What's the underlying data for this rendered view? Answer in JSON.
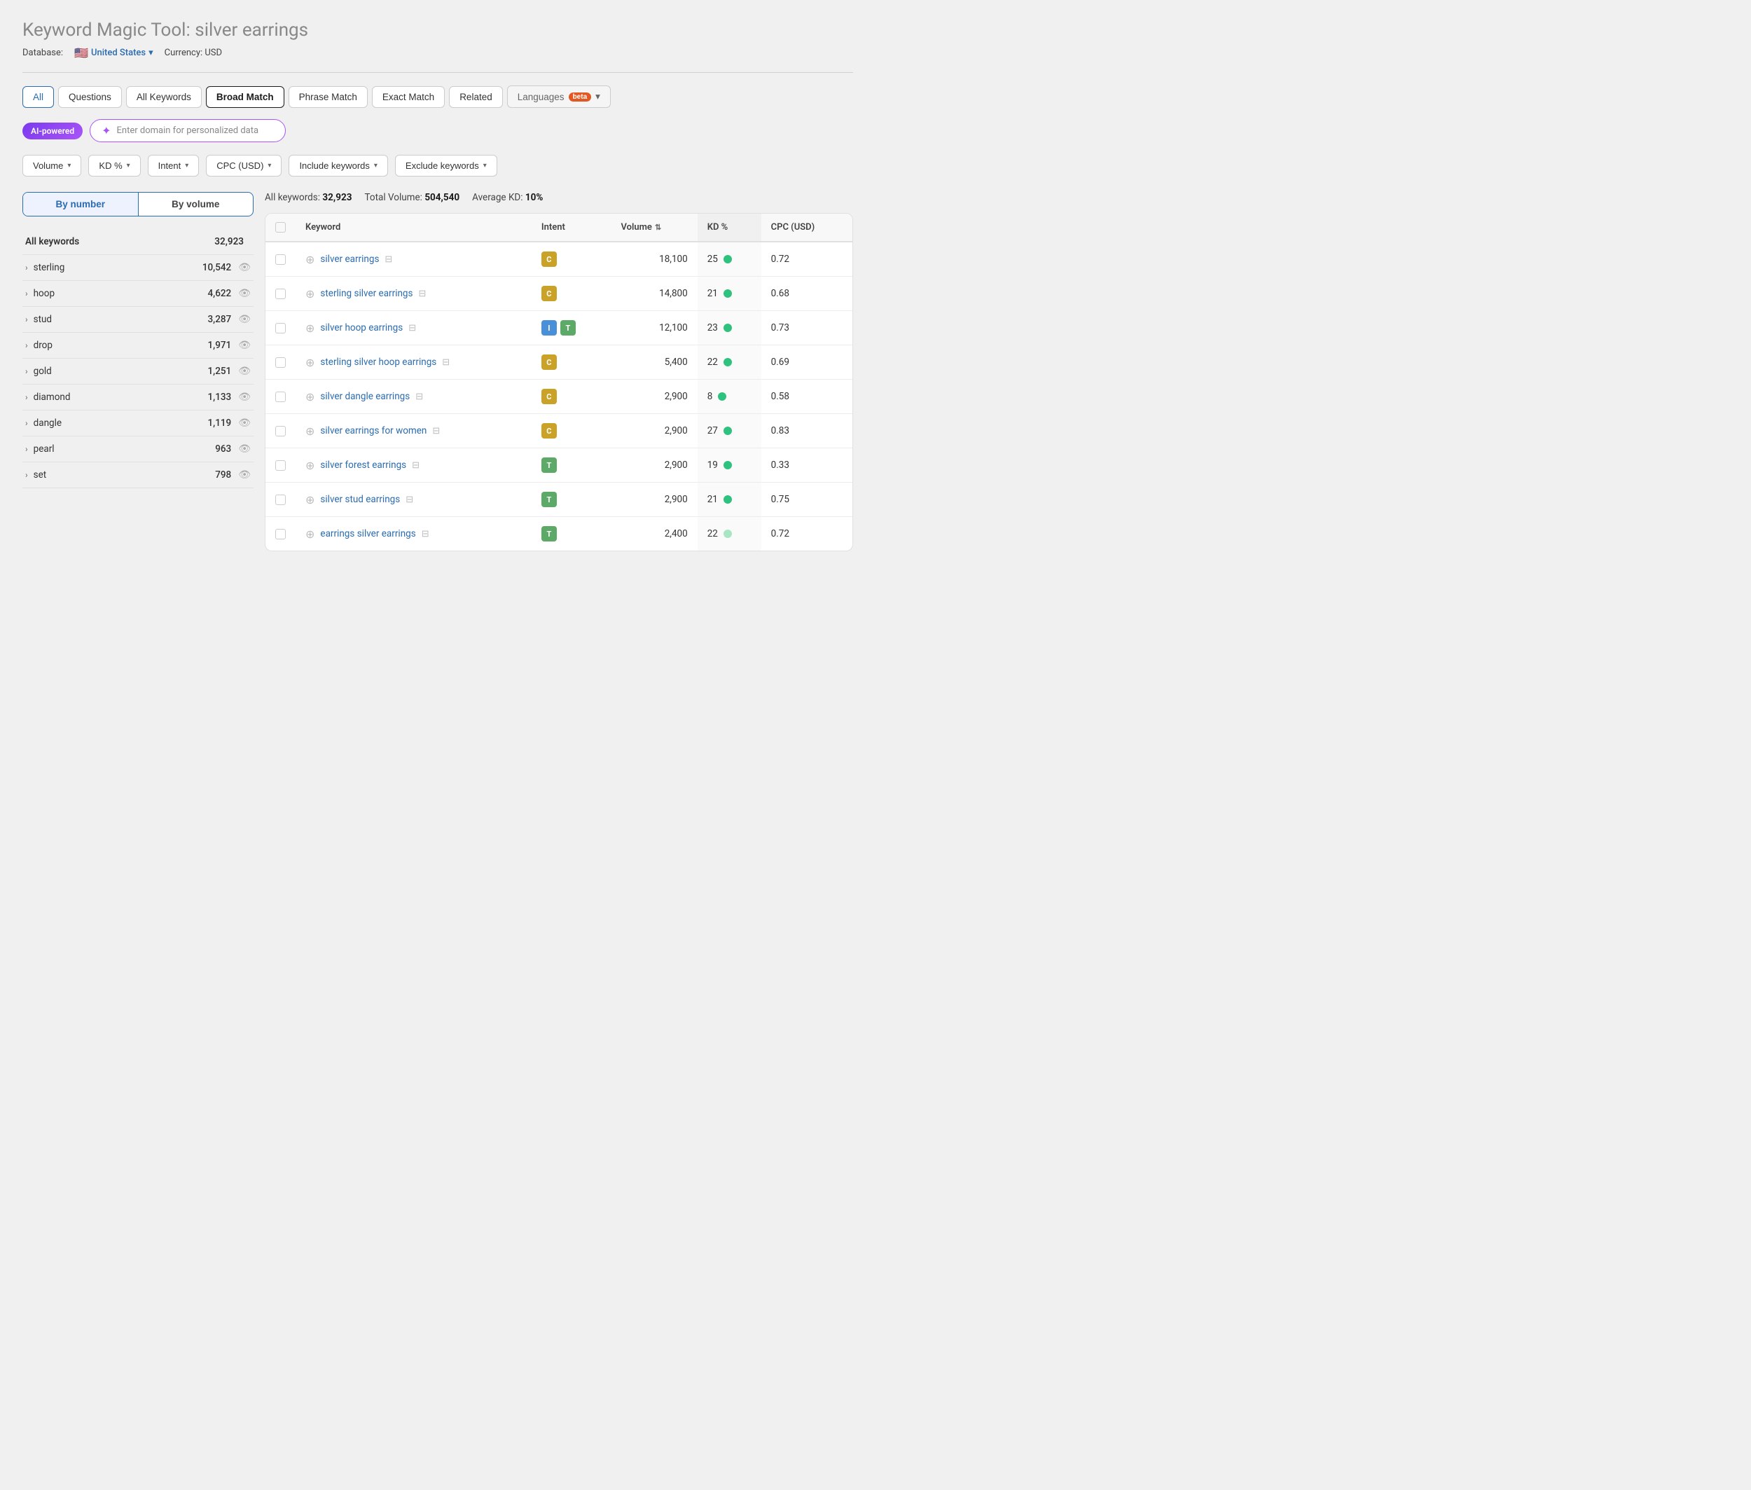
{
  "page": {
    "title": "Keyword Magic Tool:",
    "title_query": "silver earrings",
    "database_label": "Database:",
    "database_country": "United States",
    "currency_label": "Currency: USD"
  },
  "tabs": [
    {
      "id": "all",
      "label": "All",
      "active": false,
      "is_all": true
    },
    {
      "id": "questions",
      "label": "Questions",
      "active": false
    },
    {
      "id": "all_keywords",
      "label": "All Keywords",
      "active": false
    },
    {
      "id": "broad_match",
      "label": "Broad Match",
      "active": true
    },
    {
      "id": "phrase_match",
      "label": "Phrase Match",
      "active": false
    },
    {
      "id": "exact_match",
      "label": "Exact Match",
      "active": false
    },
    {
      "id": "related",
      "label": "Related",
      "active": false
    },
    {
      "id": "languages",
      "label": "Languages",
      "active": false,
      "is_languages": true,
      "beta": true
    }
  ],
  "ai_section": {
    "badge_label": "AI-powered",
    "input_placeholder": "Enter domain for personalized data"
  },
  "filters": [
    {
      "id": "volume",
      "label": "Volume"
    },
    {
      "id": "kd",
      "label": "KD %"
    },
    {
      "id": "intent",
      "label": "Intent"
    },
    {
      "id": "cpc",
      "label": "CPC (USD)"
    },
    {
      "id": "include_keywords",
      "label": "Include keywords"
    },
    {
      "id": "exclude_keywords",
      "label": "Exclude keywords"
    }
  ],
  "sort_toggle": {
    "by_number": "By number",
    "by_volume": "By volume",
    "active": "by_number"
  },
  "sidebar_items": [
    {
      "label": "All keywords",
      "count": "32,923",
      "is_all": true
    },
    {
      "label": "sterling",
      "count": "10,542"
    },
    {
      "label": "hoop",
      "count": "4,622"
    },
    {
      "label": "stud",
      "count": "3,287"
    },
    {
      "label": "drop",
      "count": "1,971"
    },
    {
      "label": "gold",
      "count": "1,251"
    },
    {
      "label": "diamond",
      "count": "1,133"
    },
    {
      "label": "dangle",
      "count": "1,119"
    },
    {
      "label": "pearl",
      "count": "963"
    },
    {
      "label": "set",
      "count": "798"
    }
  ],
  "stats": {
    "all_keywords_label": "All keywords:",
    "all_keywords_count": "32,923",
    "total_volume_label": "Total Volume:",
    "total_volume_count": "504,540",
    "avg_kd_label": "Average KD:",
    "avg_kd_value": "10%"
  },
  "table": {
    "headers": [
      "",
      "Keyword",
      "Intent",
      "Volume",
      "KD %",
      "CPC (USD)"
    ],
    "rows": [
      {
        "keyword": "silver earrings",
        "intent": [
          {
            "code": "C",
            "class": "intent-c"
          }
        ],
        "volume": "18,100",
        "kd": "25",
        "kd_dot": "green",
        "cpc": "0.72"
      },
      {
        "keyword": "sterling silver earrings",
        "intent": [
          {
            "code": "C",
            "class": "intent-c"
          }
        ],
        "volume": "14,800",
        "kd": "21",
        "kd_dot": "green",
        "cpc": "0.68"
      },
      {
        "keyword": "silver hoop earrings",
        "intent": [
          {
            "code": "I",
            "class": "intent-i"
          },
          {
            "code": "T",
            "class": "intent-t"
          }
        ],
        "volume": "12,100",
        "kd": "23",
        "kd_dot": "green",
        "cpc": "0.73"
      },
      {
        "keyword": "sterling silver hoop earrings",
        "intent": [
          {
            "code": "C",
            "class": "intent-c"
          }
        ],
        "volume": "5,400",
        "kd": "22",
        "kd_dot": "green",
        "cpc": "0.69"
      },
      {
        "keyword": "silver dangle earrings",
        "intent": [
          {
            "code": "C",
            "class": "intent-c"
          }
        ],
        "volume": "2,900",
        "kd": "8",
        "kd_dot": "green",
        "cpc": "0.58"
      },
      {
        "keyword": "silver earrings for women",
        "intent": [
          {
            "code": "C",
            "class": "intent-c"
          }
        ],
        "volume": "2,900",
        "kd": "27",
        "kd_dot": "green",
        "cpc": "0.83"
      },
      {
        "keyword": "silver forest earrings",
        "intent": [
          {
            "code": "T",
            "class": "intent-t"
          }
        ],
        "volume": "2,900",
        "kd": "19",
        "kd_dot": "green",
        "cpc": "0.33"
      },
      {
        "keyword": "silver stud earrings",
        "intent": [
          {
            "code": "T",
            "class": "intent-t"
          }
        ],
        "volume": "2,900",
        "kd": "21",
        "kd_dot": "green",
        "cpc": "0.75"
      },
      {
        "keyword": "earrings silver earrings",
        "intent": [
          {
            "code": "T",
            "class": "intent-t"
          }
        ],
        "volume": "2,400",
        "kd": "22",
        "kd_dot": "light",
        "cpc": "0.72"
      }
    ]
  }
}
